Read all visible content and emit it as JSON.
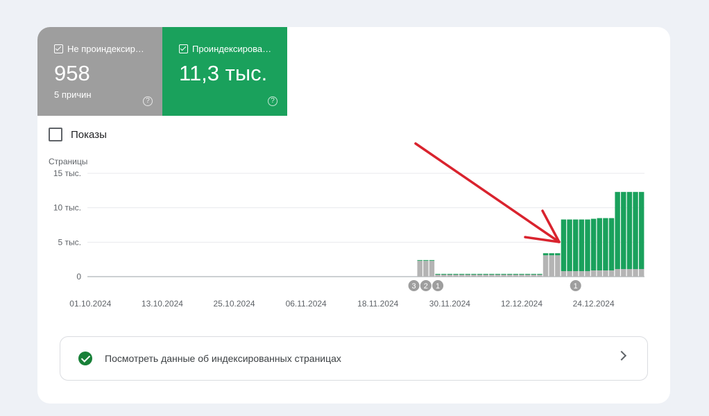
{
  "tiles": {
    "not_indexed": {
      "label": "Не проиндексир…",
      "value": "958",
      "sub": "5 причин",
      "color": "#9e9e9e"
    },
    "indexed": {
      "label": "Проиндексирова…",
      "value": "11,3 тыс.",
      "color": "#1aa15c"
    }
  },
  "impressions_label": "Показы",
  "help_glyph": "?",
  "link_text": "Посмотреть данные об индексированных страницах",
  "annotation_arrow_color": "#d9232e",
  "chart_data": {
    "type": "bar",
    "stacked": true,
    "ylabel": "Страницы",
    "ylim": [
      0,
      15000
    ],
    "y_ticks": [
      "15 тыс.",
      "10 тыс.",
      "5 тыс.",
      "0"
    ],
    "x_ticks": [
      "01.10.2024",
      "13.10.2024",
      "25.10.2024",
      "06.11.2024",
      "18.11.2024",
      "30.11.2024",
      "12.12.2024",
      "24.12.2024"
    ],
    "first_date": "01.10.2024",
    "x": [
      "25.11.2024",
      "26.11.2024",
      "27.11.2024",
      "28.11.2024",
      "29.11.2024",
      "30.11.2024",
      "01.12.2024",
      "02.12.2024",
      "03.12.2024",
      "04.12.2024",
      "05.12.2024",
      "06.12.2024",
      "07.12.2024",
      "08.12.2024",
      "09.12.2024",
      "10.12.2024",
      "11.12.2024",
      "12.12.2024",
      "13.12.2024",
      "14.12.2024",
      "15.12.2024",
      "16.12.2024",
      "17.12.2024",
      "18.12.2024",
      "19.12.2024",
      "20.12.2024",
      "21.12.2024",
      "22.12.2024",
      "23.12.2024",
      "24.12.2024",
      "25.12.2024",
      "26.12.2024",
      "27.12.2024",
      "28.12.2024",
      "29.12.2024",
      "30.12.2024",
      "31.12.2024",
      "01.01.2025"
    ],
    "series": [
      {
        "name": "Не проиндексированные",
        "color": "#b4b4b4",
        "values": [
          2300,
          2300,
          2300,
          300,
          300,
          300,
          300,
          300,
          300,
          300,
          300,
          300,
          300,
          300,
          300,
          300,
          300,
          300,
          300,
          300,
          300,
          3100,
          3100,
          3100,
          800,
          800,
          800,
          800,
          800,
          900,
          900,
          900,
          900,
          1100,
          1100,
          1100,
          1100,
          1100
        ]
      },
      {
        "name": "Проиндексированные",
        "color": "#1aa15c",
        "values": [
          100,
          100,
          100,
          100,
          100,
          100,
          100,
          100,
          100,
          100,
          100,
          100,
          100,
          100,
          100,
          100,
          100,
          100,
          100,
          100,
          100,
          300,
          300,
          300,
          7500,
          7500,
          7500,
          7500,
          7500,
          7500,
          7600,
          7600,
          7600,
          11200,
          11200,
          11200,
          11200,
          11200
        ]
      }
    ],
    "annotations": [
      {
        "date": "24.11.2024",
        "label": "3"
      },
      {
        "date": "26.11.2024",
        "label": "2"
      },
      {
        "date": "28.11.2024",
        "label": "1"
      },
      {
        "date": "21.12.2024",
        "label": "1"
      }
    ]
  }
}
